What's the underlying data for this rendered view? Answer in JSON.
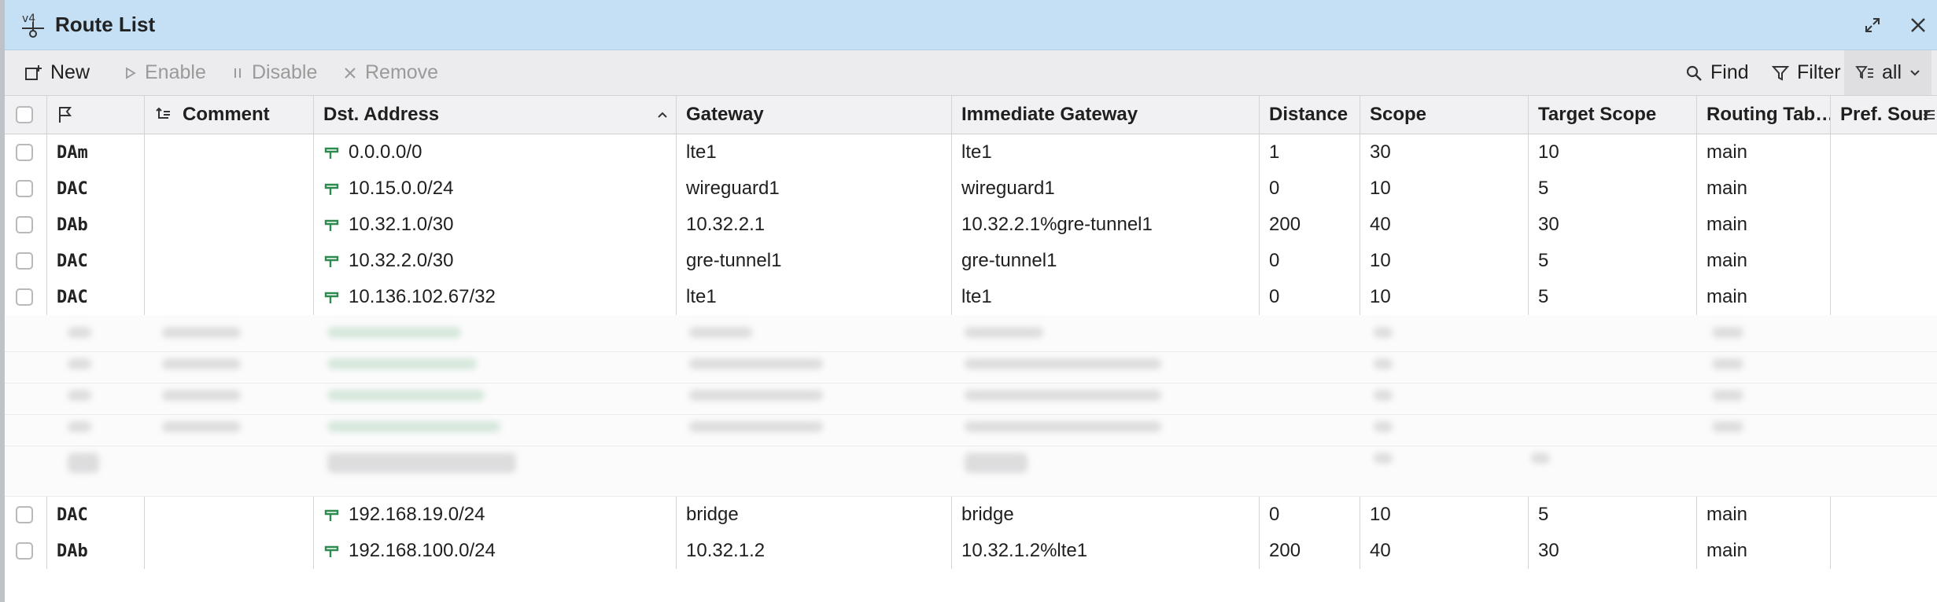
{
  "window": {
    "title": "Route List",
    "icon": "ipv4-route-icon",
    "controls": [
      "expand-icon",
      "close-icon"
    ]
  },
  "toolbar": {
    "new_label": "New",
    "enable_label": "Enable",
    "disable_label": "Disable",
    "remove_label": "Remove",
    "find_label": "Find",
    "filter_label": "Filter",
    "view_value": "all"
  },
  "columns": {
    "flags_icon": "flag-icon",
    "comment": "Comment",
    "dst_address": "Dst. Address",
    "gateway": "Gateway",
    "immediate_gateway": "Immediate Gateway",
    "distance": "Distance",
    "scope": "Scope",
    "target_scope": "Target Scope",
    "routing_table": "Routing Tab…",
    "pref_source": "Pref. Sour"
  },
  "rows": [
    {
      "flags": "DAm",
      "comment": "",
      "dst": "0.0.0.0/0",
      "gateway": "lte1",
      "immediate": "lte1",
      "distance": "1",
      "scope": "30",
      "target_scope": "10",
      "table": "main"
    },
    {
      "flags": "DAC",
      "comment": "",
      "dst": "10.15.0.0/24",
      "gateway": "wireguard1",
      "immediate": "wireguard1",
      "distance": "0",
      "scope": "10",
      "target_scope": "5",
      "table": "main"
    },
    {
      "flags": "DAb",
      "comment": "",
      "dst": "10.32.1.0/30",
      "gateway": "10.32.2.1",
      "immediate": "10.32.2.1%gre-tunnel1",
      "distance": "200",
      "scope": "40",
      "target_scope": "30",
      "table": "main"
    },
    {
      "flags": "DAC",
      "comment": "",
      "dst": "10.32.2.0/30",
      "gateway": "gre-tunnel1",
      "immediate": "gre-tunnel1",
      "distance": "0",
      "scope": "10",
      "target_scope": "5",
      "table": "main"
    },
    {
      "flags": "DAC",
      "comment": "",
      "dst": "10.136.102.67/32",
      "gateway": "lte1",
      "immediate": "lte1",
      "distance": "0",
      "scope": "10",
      "target_scope": "5",
      "table": "main"
    },
    {
      "flags": "DAC",
      "comment": "",
      "dst": "192.168.19.0/24",
      "gateway": "bridge",
      "immediate": "bridge",
      "distance": "0",
      "scope": "10",
      "target_scope": "5",
      "table": "main"
    },
    {
      "flags": "DAb",
      "comment": "",
      "dst": "192.168.100.0/24",
      "gateway": "10.32.1.2",
      "immediate": "10.32.1.2%lte1",
      "distance": "200",
      "scope": "40",
      "target_scope": "30",
      "table": "main"
    }
  ],
  "colors": {
    "titlebar": "#c5e0f5",
    "toolbar": "#ececee",
    "route_icon": "#2e8b4f"
  }
}
